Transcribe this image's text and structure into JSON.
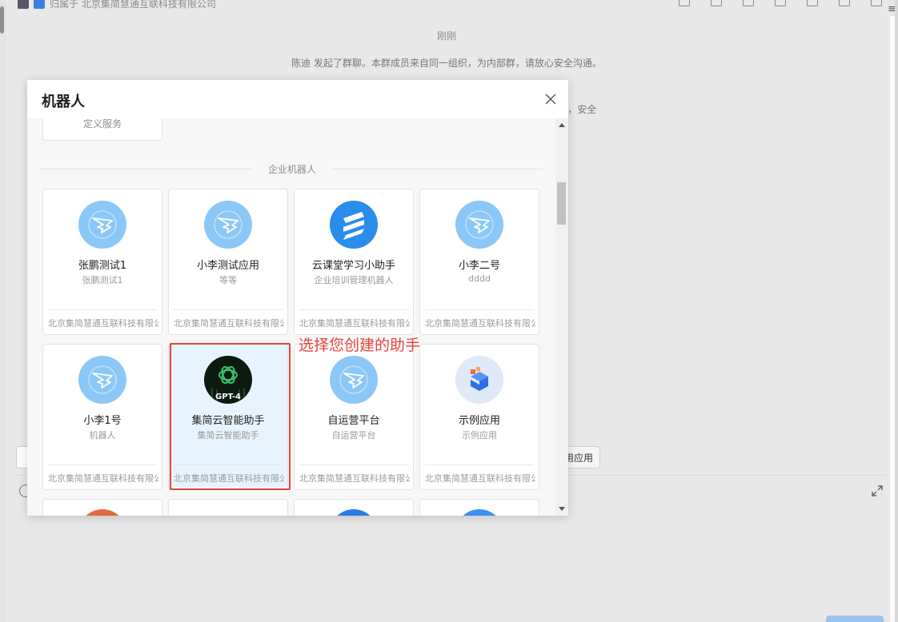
{
  "chat": {
    "header_org": "归属于 北京集简慧通互联科技有限公司",
    "time": "刚刚",
    "system_message": "陈迪 发起了群聊。本群成员来自同一组织，为内部群，请放心安全沟通。",
    "system_message_2": "”，安全",
    "app_button_label": "用应用",
    "right_glyph": "≡"
  },
  "modal": {
    "title": "机器人",
    "close_icon": "close-icon",
    "partial_card_text": "定义服务",
    "section_label": "企业机器人"
  },
  "robots": [
    {
      "name": "张鹏测试1",
      "desc": "张鹏测试1",
      "org": "北京集简慧通互联科技有限公司",
      "icon": "ding-robot-icon"
    },
    {
      "name": "小李测试应用",
      "desc": "等等",
      "org": "北京集简慧通互联科技有限公司",
      "icon": "ding-robot-icon"
    },
    {
      "name": "云课堂学习小助手",
      "desc": "企业培训管理机器人",
      "org": "北京集简慧通互联科技有限公司",
      "icon": "cloud-classroom-icon"
    },
    {
      "name": "小李二号",
      "desc": "dddd",
      "org": "北京集简慧通互联科技有限公司",
      "icon": "ding-robot-icon"
    },
    {
      "name": "小李1号",
      "desc": "机器人",
      "org": "北京集简慧通互联科技有限公司",
      "icon": "ding-robot-icon"
    },
    {
      "name": "集简云智能助手",
      "desc": "集简云智能助手",
      "org": "北京集简慧通互联科技有限公司",
      "icon": "gpt4-icon",
      "selected": true,
      "icon_badge": "GPT-4"
    },
    {
      "name": "自运营平台",
      "desc": "自运营平台",
      "org": "北京集简慧通互联科技有限公司",
      "icon": "ding-robot-icon"
    },
    {
      "name": "示例应用",
      "desc": "示例应用",
      "org": "北京集简慧通互联科技有限公司",
      "icon": "sample-app-icon"
    }
  ],
  "annotation": "选择您创建的助手",
  "colors": {
    "accent_red": "#e0453a",
    "selected_bg": "#e8f4fd",
    "robot_icon_bg": "#8cc8f7"
  }
}
